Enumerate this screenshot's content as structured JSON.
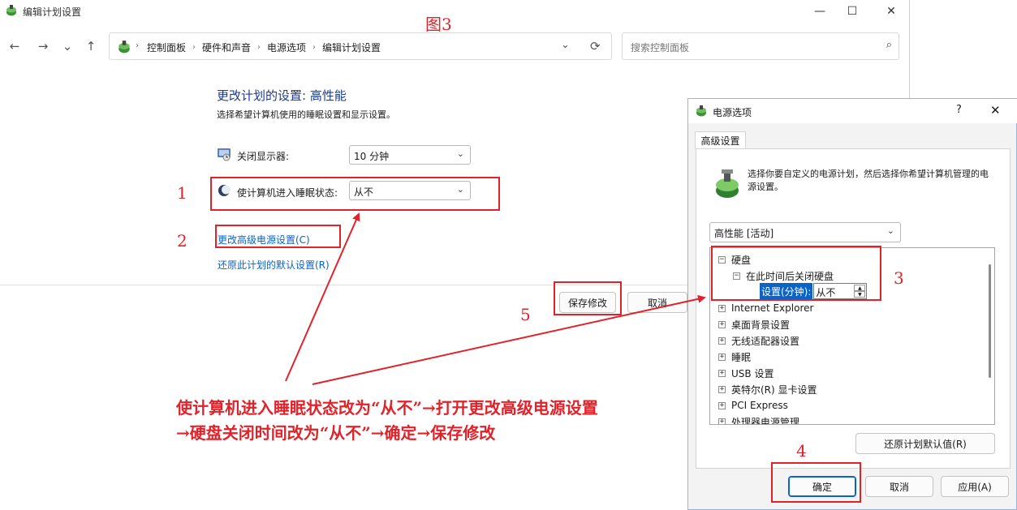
{
  "window": {
    "title": "编辑计划设置",
    "controls": [
      "—",
      "☐",
      "✕"
    ]
  },
  "nav": {
    "back": "←",
    "forward": "→",
    "recent": "⌄",
    "up": "↑",
    "breadcrumb": [
      "控制面板",
      "硬件和声音",
      "电源选项",
      "编辑计划设置"
    ],
    "dropdown": "⌄",
    "refresh": "⟳",
    "search_placeholder": "搜索控制面板",
    "search_icon": "⌕"
  },
  "content": {
    "heading": "更改计划的设置: 高性能",
    "subtext": "选择希望计算机使用的睡眠设置和显示设置。",
    "display_off_label": "关闭显示器:",
    "display_off_value": "10 分钟",
    "sleep_label": "使计算机进入睡眠状态:",
    "sleep_value": "从不",
    "advanced_link": "更改高级电源设置(C)",
    "restore_link": "还原此计划的默认设置(R)",
    "save_button": "保存修改",
    "cancel_button": "取消",
    "chevron": "⌄"
  },
  "dialog": {
    "title": "电源选项",
    "help": "?",
    "close": "✕",
    "tab": "高级设置",
    "description": "选择你要自定义的电源计划，然后选择你希望计算机管理的电源设置。",
    "plan_value": "高性能 [活动]",
    "tree": {
      "hdd": "硬盘",
      "hdd_child": "在此时间后关闭硬盘",
      "setting_label": "设置(分钟):",
      "setting_value": "从不",
      "items": [
        "Internet Explorer",
        "桌面背景设置",
        "无线适配器设置",
        "睡眠",
        "USB 设置",
        "英特尔(R) 显卡设置",
        "PCI Express",
        "处理器电源管理"
      ]
    },
    "restore_defaults": "还原计划默认值(R)",
    "ok": "确定",
    "cancel": "取消",
    "apply": "应用(A)"
  },
  "annotations": {
    "figure_label": "图3",
    "numbers": [
      "1",
      "2",
      "3",
      "4",
      "5"
    ],
    "instruction_line1": "使计算机进入睡眠状态改为“从不”→打开更改高级电源设置",
    "instruction_line2": "→硬盘关闭时间改为“从不”→确定→保存修改",
    "color": "#e0222a"
  }
}
